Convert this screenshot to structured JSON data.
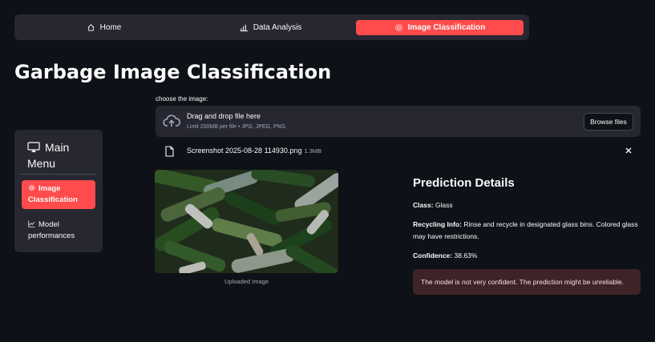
{
  "nav": {
    "items": [
      {
        "label": "Home",
        "icon": "home-icon",
        "active": false
      },
      {
        "label": "Data Analysis",
        "icon": "bar-chart-icon",
        "active": false
      },
      {
        "label": "Image Classification",
        "icon": "gear-icon",
        "active": true
      }
    ]
  },
  "page": {
    "title": "Garbage Image Classification"
  },
  "sidebar": {
    "title": "Main Menu",
    "items": [
      {
        "label": "Image Classification",
        "icon": "gear-icon",
        "active": true
      },
      {
        "label": "Model performances",
        "icon": "line-chart-icon",
        "active": false
      }
    ]
  },
  "uploader": {
    "label": "choose the image:",
    "drop_text": "Drag and drop file here",
    "limit_text": "Limit 200MB per file • JPG, JPEG, PNG",
    "browse_label": "Browse files",
    "file": {
      "name": "Screenshot 2025-08-28 114930.png",
      "size": "1.3MB"
    }
  },
  "image": {
    "caption": "Uploaded Image"
  },
  "prediction": {
    "title": "Prediction Details",
    "class_label": "Class:",
    "class_value": "Glass",
    "recycling_label": "Recycling Info:",
    "recycling_value": "Rinse and recycle in designated glass bins. Colored glass may have restrictions.",
    "confidence_label": "Confidence:",
    "confidence_value": "38.63%",
    "warning": "The model is not very confident. The prediction might be unreliable."
  },
  "colors": {
    "accent": "#ff4b4b",
    "background": "#0e1117",
    "panel": "#262730",
    "warning_bg": "#3e2428"
  }
}
